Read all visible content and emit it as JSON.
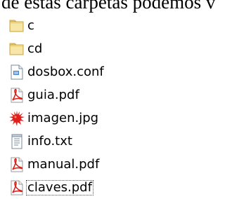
{
  "caption": "de estas carpetas podemos v",
  "files": [
    {
      "name": "c",
      "icon": "folder-icon",
      "focused": false
    },
    {
      "name": "cd",
      "icon": "folder-icon",
      "focused": false
    },
    {
      "name": "dosbox.conf",
      "icon": "config-file-icon",
      "focused": false
    },
    {
      "name": "guia.pdf",
      "icon": "pdf-icon",
      "focused": false
    },
    {
      "name": "imagen.jpg",
      "icon": "image-file-icon",
      "focused": false
    },
    {
      "name": "info.txt",
      "icon": "text-file-icon",
      "focused": false
    },
    {
      "name": "manual.pdf",
      "icon": "pdf-icon",
      "focused": false
    },
    {
      "name": "claves.pdf",
      "icon": "pdf-icon",
      "focused": true
    }
  ],
  "colors": {
    "folder": "#f2d98c",
    "folder_border": "#c8a94a",
    "pdf_red": "#d8231f",
    "image_red": "#e0201c",
    "doc_border": "#7a8899"
  }
}
